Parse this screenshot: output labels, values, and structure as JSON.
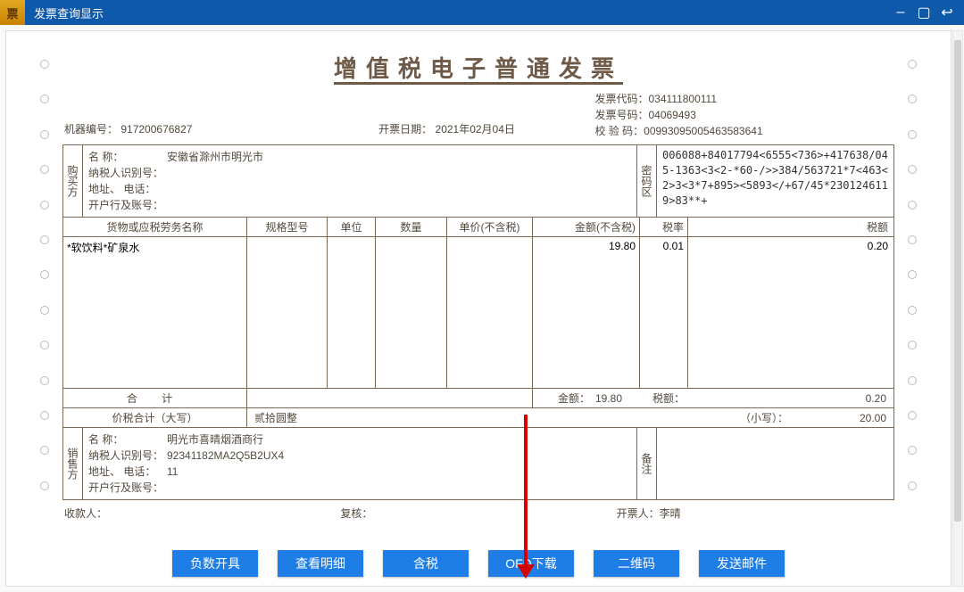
{
  "window": {
    "title": "发票查询显示"
  },
  "invoice": {
    "title": "增值税电子普通发票",
    "machine_no_label": "机器编号：",
    "machine_no": "917200676827",
    "issue_date_label": "开票日期：",
    "issue_date": "2021年02月04日",
    "meta": {
      "code_label": "发票代码：",
      "code": "034111800111",
      "number_label": "发票号码：",
      "number": "04069493",
      "check_label": "校 验 码：",
      "check": "00993095005463583641"
    },
    "buyer": {
      "section": "购买方",
      "name_label": "名        称：",
      "name": "安徽省滁州市明光市",
      "taxid_label": "纳税人识别号：",
      "taxid": "",
      "addrtel_label": "地址、 电话：",
      "addrtel": "",
      "bank_label": "开户行及账号：",
      "bank": ""
    },
    "cipher": {
      "label": "密码区",
      "text": "006088+84017794<6555<736>+417638/045-1363<3<2-*60-/>>384/563721*7<463<2>3<3*7+895><5893</+67/45*2301246119>83**+"
    },
    "columns": {
      "name": "货物或应税劳务名称",
      "spec": "规格型号",
      "unit": "单位",
      "qty": "数量",
      "price": "单价(不含税)",
      "amount": "金额(不含税)",
      "rate": "税率",
      "tax": "税额"
    },
    "line": {
      "name": "*软饮料*矿泉水",
      "spec": "",
      "unit": "",
      "qty": "",
      "price": "",
      "amount": "19.80",
      "rate": "0.01",
      "tax": "0.20"
    },
    "total": {
      "label": "合    计",
      "amount_label": "金额：",
      "amount": "19.80",
      "tax_label": "税额：",
      "tax": "0.20"
    },
    "capital": {
      "label": "价税合计（大写）",
      "upper": "贰拾圆整",
      "lower_label": "（小写）：",
      "lower": "20.00"
    },
    "seller": {
      "section": "销售方",
      "name_label": "名        称：",
      "name": "明光市喜晴烟酒商行",
      "taxid_label": "纳税人识别号：",
      "taxid": "92341182MA2Q5B2UX4",
      "addrtel_label": "地址、 电话：",
      "addrtel": "11",
      "bank_label": "开户行及账号：",
      "bank": ""
    },
    "remark_label": "备注",
    "signers": {
      "payee_label": "收款人：",
      "payee": "",
      "reviewer_label": "复核：",
      "reviewer": "",
      "issuer_label": "开票人：",
      "issuer": "李晴"
    }
  },
  "buttons": {
    "neg": "负数开具",
    "detail": "查看明细",
    "tax": "含税",
    "ofd": "OFD下载",
    "qr": "二维码",
    "mail": "发送邮件"
  }
}
